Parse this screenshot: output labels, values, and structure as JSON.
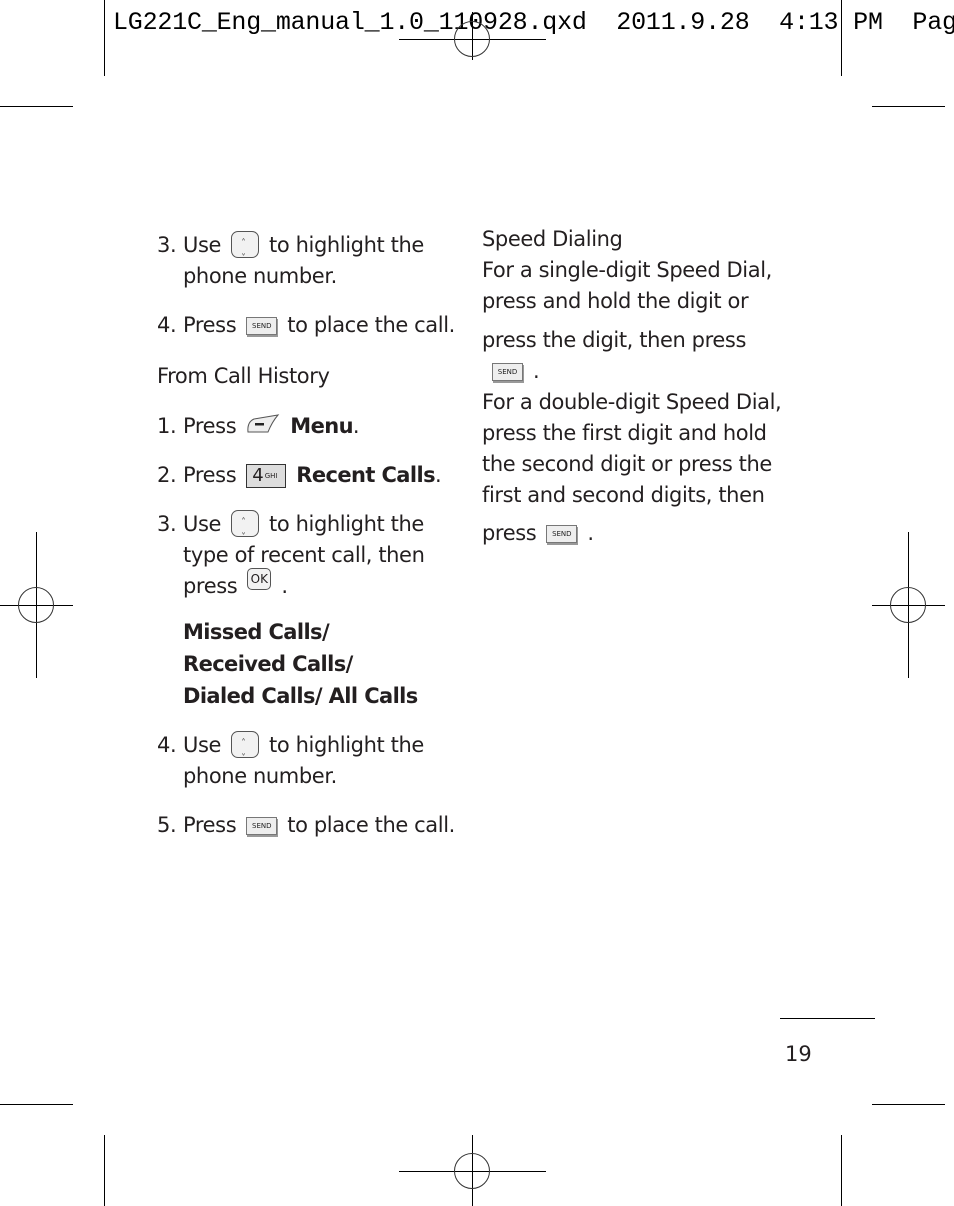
{
  "slug": {
    "filename": "LG221C_Eng_manual_1.0_110928.qxd",
    "date": "2011.9.28",
    "time": "4:13",
    "ampm": "PM",
    "page_label": "Page"
  },
  "left_column": {
    "steps_top": [
      {
        "num": "3.",
        "pre": "Use",
        "icon": "nav-key",
        "post": "to highlight the phone number."
      },
      {
        "num": "4.",
        "pre": "Press",
        "icon": "send-key",
        "post": "to place the call."
      }
    ],
    "section_heading": "From Call History",
    "steps_history": [
      {
        "num": "1.",
        "pre": "Press",
        "icon": "left-soft-key",
        "post_bold": "Menu",
        "post": "."
      },
      {
        "num": "2.",
        "pre": "Press",
        "icon": "4-ghi-key",
        "post_bold": "Recent Calls",
        "post": "."
      },
      {
        "num": "3.",
        "pre": "Use",
        "icon": "nav-key",
        "line1_post": "to highlight the",
        "line2": "type of recent call, then",
        "line3_pre": "press",
        "icon2": "ok-key",
        "line3_post": "."
      },
      {
        "num": "4.",
        "pre": "Use",
        "icon": "nav-key",
        "post": "to highlight the phone number."
      },
      {
        "num": "5.",
        "pre": "Press",
        "icon": "send-key",
        "post": "to place the call."
      }
    ],
    "options_bold": "Missed Calls/ Received Calls/ Dialed Calls/ All Calls"
  },
  "right_column": {
    "heading": "Speed Dialing",
    "para1_lines": [
      "For a single-digit Speed Dial,",
      "press and hold the digit or"
    ],
    "para1_last_pre": "press the digit, then press",
    "para1_last_post": ".",
    "para2_lines": [
      "For a double-digit Speed Dial,",
      "press the first digit and hold",
      "the second digit or press the",
      "first and second digits, then"
    ],
    "para2_last_pre": "press",
    "para2_last_post": "."
  },
  "keys": {
    "send_label": "SEND",
    "ok_label": "OK",
    "four_digit": "4",
    "four_letters": "GHI"
  },
  "page_number": "19"
}
